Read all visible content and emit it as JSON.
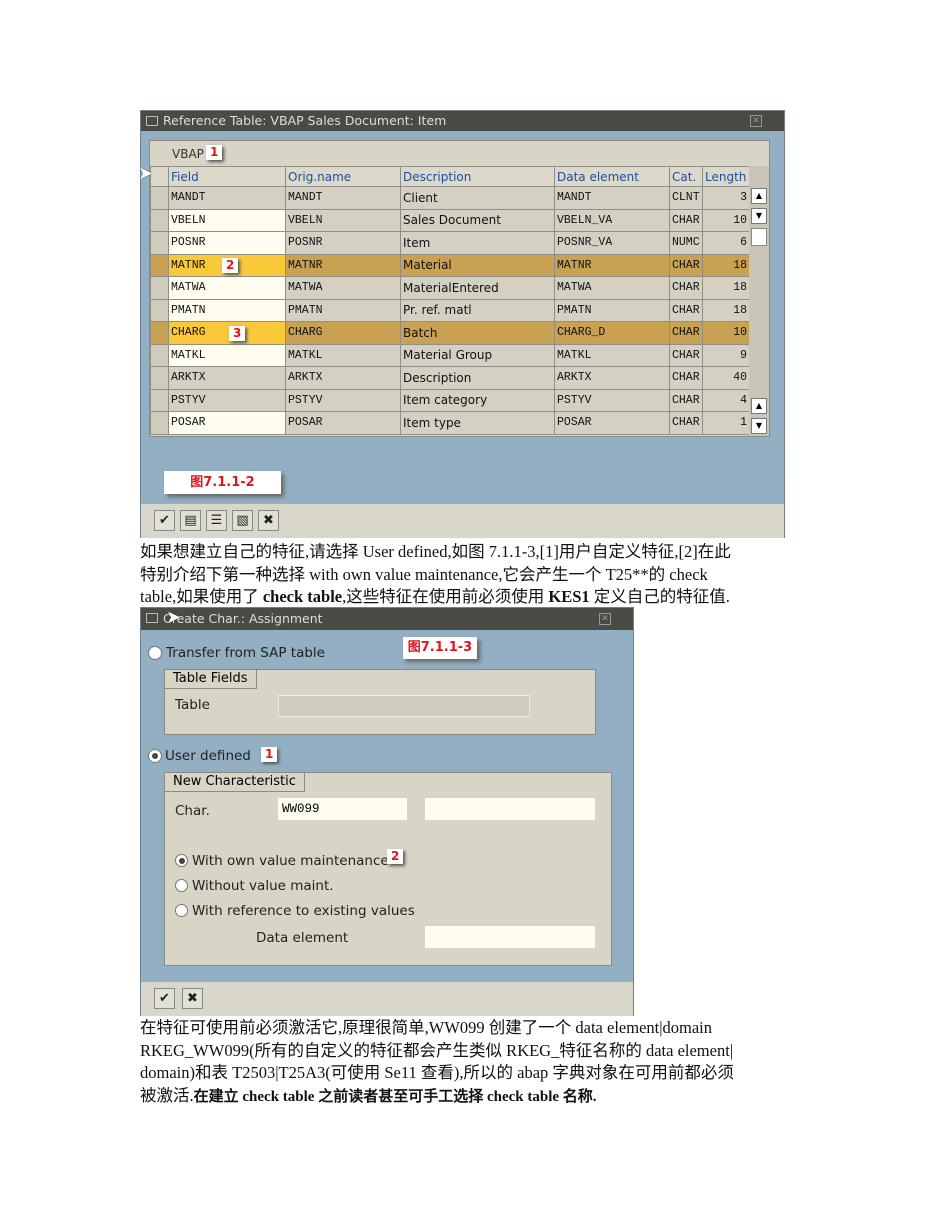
{
  "dialog1": {
    "title": "Reference Table: VBAP Sales Document: Item",
    "table_name": "VBAP",
    "badges": [
      "1",
      "2",
      "3"
    ],
    "figure_label": "图7.1.1-2",
    "columns": [
      "Field",
      "Orig.name",
      "Description",
      "Data element",
      "Cat.",
      "Length"
    ],
    "rows": [
      {
        "field": "MANDT",
        "orig": "MANDT",
        "desc": "Client",
        "elem": "MANDT",
        "cat": "CLNT",
        "len": "3"
      },
      {
        "field": "VBELN",
        "orig": "VBELN",
        "desc": "Sales Document",
        "elem": "VBELN_VA",
        "cat": "CHAR",
        "len": "10"
      },
      {
        "field": "POSNR",
        "orig": "POSNR",
        "desc": "Item",
        "elem": "POSNR_VA",
        "cat": "NUMC",
        "len": "6"
      },
      {
        "field": "MATNR",
        "orig": "MATNR",
        "desc": "Material",
        "elem": "MATNR",
        "cat": "CHAR",
        "len": "18"
      },
      {
        "field": "MATWA",
        "orig": "MATWA",
        "desc": "MaterialEntered",
        "elem": "MATWA",
        "cat": "CHAR",
        "len": "18"
      },
      {
        "field": "PMATN",
        "orig": "PMATN",
        "desc": "Pr. ref. matl",
        "elem": "PMATN",
        "cat": "CHAR",
        "len": "18"
      },
      {
        "field": "CHARG",
        "orig": "CHARG",
        "desc": "Batch",
        "elem": "CHARG_D",
        "cat": "CHAR",
        "len": "10"
      },
      {
        "field": "MATKL",
        "orig": "MATKL",
        "desc": "Material Group",
        "elem": "MATKL",
        "cat": "CHAR",
        "len": "9"
      },
      {
        "field": "ARKTX",
        "orig": "ARKTX",
        "desc": "Description",
        "elem": "ARKTX",
        "cat": "CHAR",
        "len": "40"
      },
      {
        "field": "PSTYV",
        "orig": "PSTYV",
        "desc": "Item category",
        "elem": "PSTYV",
        "cat": "CHAR",
        "len": "4"
      },
      {
        "field": "POSAR",
        "orig": "POSAR",
        "desc": "Item type",
        "elem": "POSAR",
        "cat": "CHAR",
        "len": "1"
      }
    ]
  },
  "para1": {
    "l1": "如果想建立自己的特征,请选择 User defined,如图 7.1.1-3,[1]用户自定义特征,[2]在此",
    "l2": "特别介绍下第一种选择 with own value maintenance,它会产生一个 T25**的 check",
    "l3a": "table,如果使用了 ",
    "l3b": "check table",
    "l3c": ",这些特征在使用前必须使用 ",
    "l3d": "KES1",
    "l3e": " 定义自己的特征值."
  },
  "dialog2": {
    "title": "Create Char.: Assignment",
    "figure_label": "图7.1.1-3",
    "transfer_label": "Transfer from SAP table",
    "table_fields_group": "Table Fields",
    "table_label": "Table",
    "table_value": "",
    "user_defined_label": "User defined",
    "badge1": "1",
    "new_char_group": "New Characteristic",
    "char_label": "Char.",
    "char_value": "WW099",
    "char_desc_value": "",
    "opt_own": "With own value maintenance",
    "badge2": "2",
    "opt_without": "Without value maint.",
    "opt_reference": "With reference to existing values",
    "data_element_label": "Data element",
    "data_element_value": ""
  },
  "para2": {
    "l1": "在特征可使用前必须激活它,原理很简单,WW099 创建了一个 data element|domain",
    "l2": "RKEG_WW099(所有的自定义的特征都会产生类似 RKEG_特征名称的 data element|",
    "l3": "domain)和表 T2503|T25A3(可使用 Se11 查看),所以的 abap 字典对象在可用前都必须",
    "l4a": "被激活.",
    "l4b": "在建立 check table 之前读者甚至可手工选择 check table 名称."
  }
}
